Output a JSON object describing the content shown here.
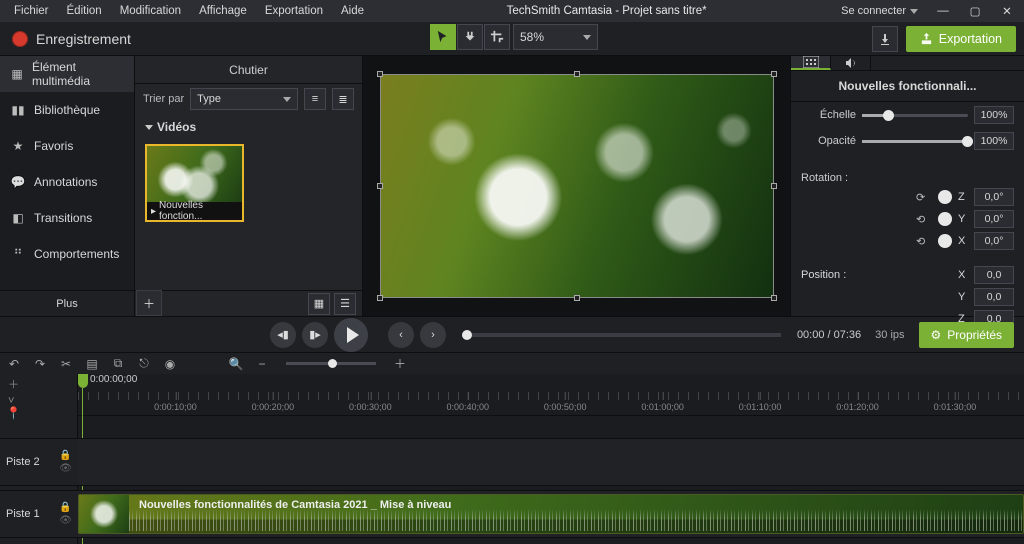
{
  "menu": {
    "file": "Fichier",
    "edit": "Édition",
    "modify": "Modification",
    "view": "Affichage",
    "export": "Exportation",
    "help": "Aide"
  },
  "app_title": "TechSmith Camtasia - Projet sans titre*",
  "signin": "Se connecter",
  "record_label": "Enregistrement",
  "zoom": "58%",
  "export_btn": "Exportation",
  "sidebar": {
    "items": [
      {
        "label": "Élément multimédia"
      },
      {
        "label": "Bibliothèque"
      },
      {
        "label": "Favoris"
      },
      {
        "label": "Annotations"
      },
      {
        "label": "Transitions"
      },
      {
        "label": "Comportements"
      }
    ],
    "more": "Plus"
  },
  "bin": {
    "title": "Chutier",
    "sort_label": "Trier par",
    "sort_value": "Type",
    "category": "Vidéos",
    "clip_name": "Nouvelles fonction..."
  },
  "props": {
    "title": "Nouvelles fonctionnali...",
    "scale_label": "Échelle",
    "scale_value": "100%",
    "opacity_label": "Opacité",
    "opacity_value": "100%",
    "rotation_label": "Rotation :",
    "rot_z": "Z",
    "rot_y": "Y",
    "rot_x": "X",
    "rot_val": "0,0°",
    "position_label": "Position :",
    "pos_x": "X",
    "pos_y": "Y",
    "pos_z": "Z",
    "pos_val": "0,0"
  },
  "transport": {
    "current": "00:00",
    "total": "07:36",
    "fps": "30 ips",
    "props_btn": "Propriétés"
  },
  "timeline": {
    "playhead_time": "0:00:00;00",
    "ticks": [
      "0:00:10;00",
      "0:00:20;00",
      "0:00:30;00",
      "0:00:40;00",
      "0:00:50;00",
      "0:01:00;00",
      "0:01:10;00",
      "0:01:20;00",
      "0:01:30;00"
    ],
    "track2": "Piste 2",
    "track1": "Piste 1",
    "clip_title": "Nouvelles fonctionnalités de Camtasia 2021 _ Mise à niveau"
  }
}
